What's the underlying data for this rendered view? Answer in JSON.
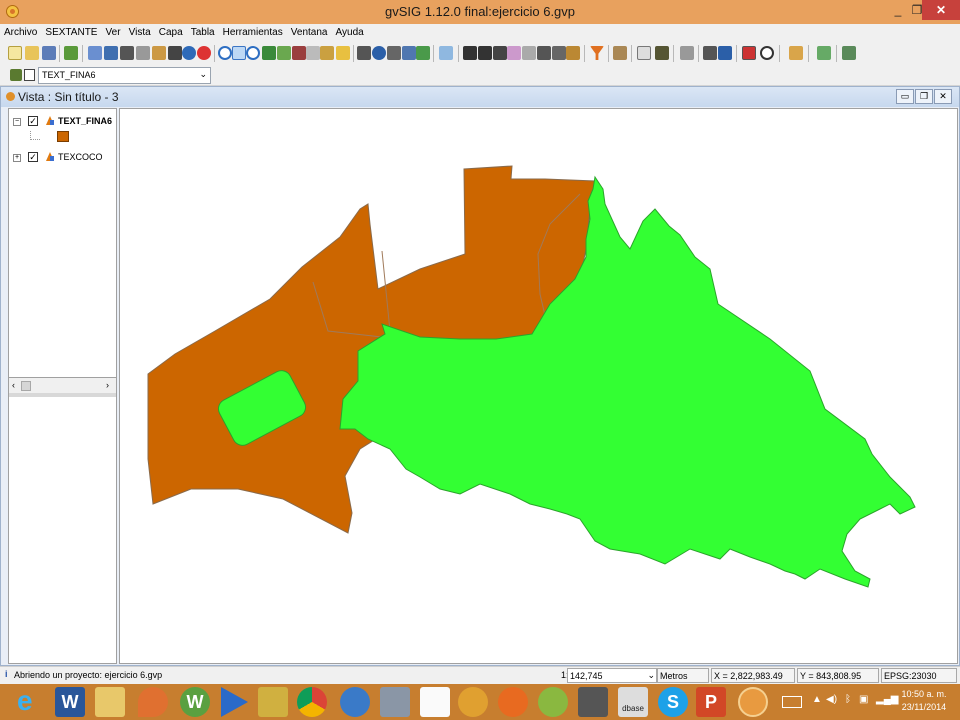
{
  "window": {
    "title": "gvSIG 1.12.0 final:ejercicio 6.gvp",
    "controls": {
      "minimize": "_",
      "restore": "❐",
      "close": "✕"
    }
  },
  "menu": {
    "items": [
      "Archivo",
      "SEXTANTE",
      "Ver",
      "Vista",
      "Capa",
      "Tabla",
      "Herramientas",
      "Ventana",
      "Ayuda"
    ]
  },
  "toolbar": {
    "active_layer": "TEXT_FINA6",
    "icons": [
      "new-file-icon",
      "open-file-icon",
      "save-icon",
      "sextante-icon",
      "layers-icon",
      "catalog-icon",
      "zoom-in-icon",
      "zoom-out-icon",
      "pan-icon",
      "info-icon",
      "select-icon",
      "filter-icon",
      "table-icon",
      "print-icon",
      "locator-icon"
    ]
  },
  "view": {
    "title": "Vista : Sin título - 3",
    "toc": {
      "layers": [
        {
          "name": "TEXT_FINA6",
          "checked": true,
          "expanded": true,
          "bold": true,
          "legend_color": "#cc6600"
        },
        {
          "name": "TEXCOCO",
          "checked": true,
          "expanded": false,
          "bold": false
        }
      ]
    },
    "map": {
      "fill_colors": {
        "brown_layer": "#cc6600",
        "green_layer": "#33ff33"
      }
    }
  },
  "status": {
    "message": "Abriendo un proyecto: ejercicio 6.gvp",
    "scale_prefix": "1:",
    "scale_value": "142,745",
    "units": "Metros",
    "x_coord": "X = 2,822,983.49",
    "y_coord": "Y = 843,808.95",
    "epsg": "EPSG:23030"
  },
  "taskbar": {
    "time": "10:50 a. m.",
    "date": "23/11/2014",
    "apps": [
      "ie-icon",
      "word-icon",
      "file-explorer-icon",
      "maps-icon",
      "word-alt-icon",
      "media-player-icon",
      "archive-icon",
      "chrome-icon",
      "search-app-icon",
      "calculator-icon",
      "document-icon",
      "sextante-app-icon",
      "firefox-icon",
      "qgis-icon",
      "microphone-icon",
      "dbase-icon",
      "skype-icon",
      "powerpoint-icon",
      "gvsig-icon"
    ]
  }
}
